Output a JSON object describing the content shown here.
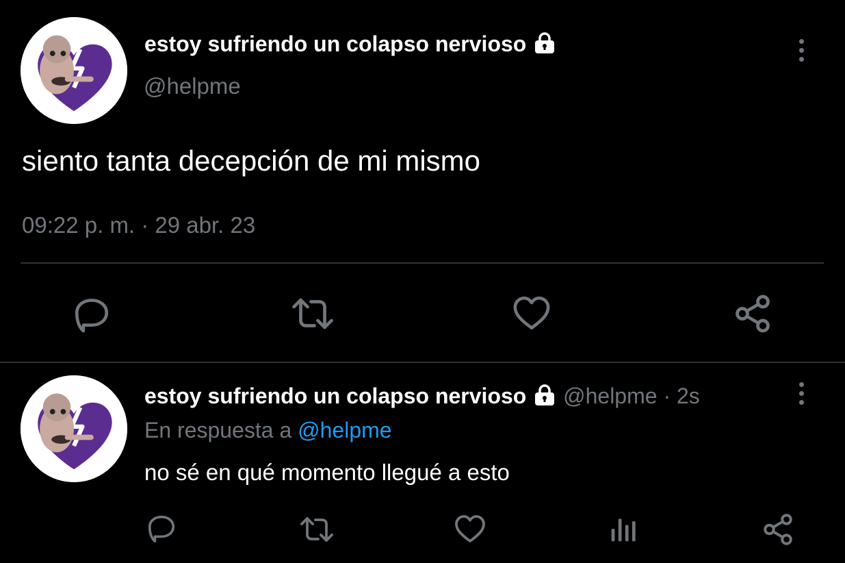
{
  "main_tweet": {
    "display_name": "estoy sufriendo un colapso nervioso",
    "handle": "@helpme",
    "text": "siento tanta decepción de mi mismo",
    "timestamp": "09:22 p. m. · 29 abr. 23"
  },
  "reply_tweet": {
    "display_name": "estoy sufriendo un colapso nervioso",
    "handle": "@helpme",
    "separator": "·",
    "time_ago": "2s",
    "reply_prefix": "En respuesta a",
    "reply_to": "@helpme",
    "text": "no sé en qué momento llegué a esto"
  },
  "icons": {
    "lock": "lock-icon",
    "more": "more-vertical-icon",
    "reply": "reply-icon",
    "retweet": "retweet-icon",
    "like": "heart-icon",
    "share": "share-icon",
    "views": "analytics-icon"
  },
  "colors": {
    "background": "#000000",
    "text_primary": "#ffffff",
    "text_muted": "#71767b",
    "link": "#1d9bf0",
    "divider": "#2f3336",
    "avatar_heart": "#6a3aa0"
  }
}
